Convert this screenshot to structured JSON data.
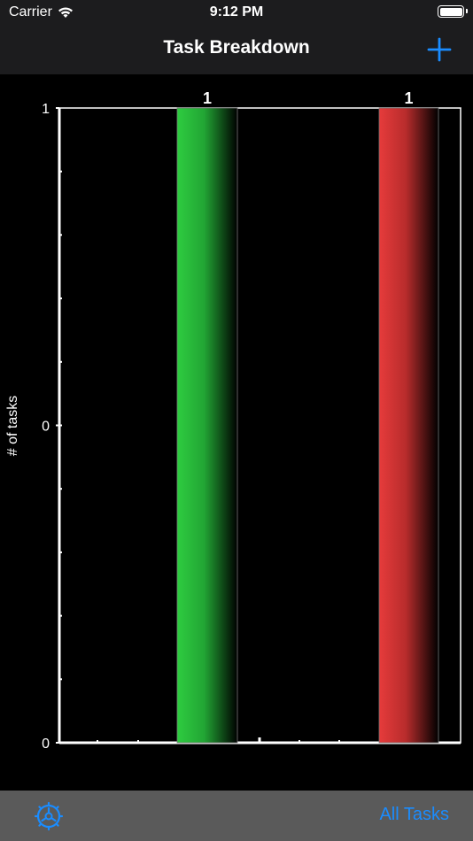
{
  "status_bar": {
    "carrier": "Carrier",
    "time": "9:12 PM",
    "wifi_icon": "wifi-icon",
    "battery_icon": "battery-icon"
  },
  "nav": {
    "title": "Task Breakdown",
    "add_icon": "plus-icon"
  },
  "chart_data": {
    "type": "bar",
    "ylabel": "# of tasks",
    "y_ticks": [
      "1",
      "0",
      "0"
    ],
    "bars": [
      {
        "value": 1,
        "label": "1",
        "color": "#2ecc40"
      },
      {
        "value": 1,
        "label": "1",
        "color": "#e63b3b"
      }
    ],
    "grid": false
  },
  "tab_bar": {
    "settings_icon": "gear-icon",
    "all_tasks_label": "All Tasks",
    "accent": "#1a8cff"
  }
}
